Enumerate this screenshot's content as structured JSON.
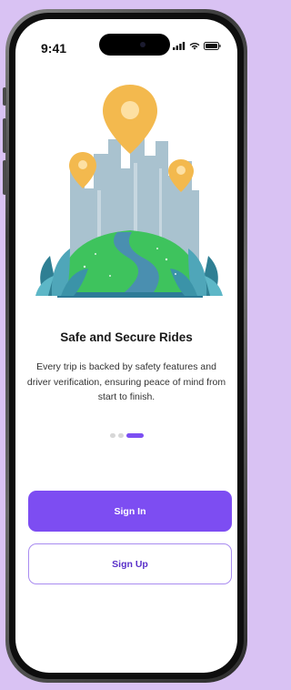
{
  "status_bar": {
    "time": "9:41"
  },
  "onboarding": {
    "title": "Safe and Secure Rides",
    "description": "Every trip is backed by safety features and driver verification, ensuring peace of mind from start to finish.",
    "page_indicator": {
      "total": 3,
      "current": 3
    }
  },
  "actions": {
    "sign_in_label": "Sign In",
    "sign_up_label": "Sign Up"
  },
  "colors": {
    "accent": "#7d4df2",
    "background": "#d9c2f3",
    "pin": "#f3b94e",
    "hill": "#3ec35d",
    "road": "#4a8fb0",
    "buildings": "#a9c2cf"
  }
}
